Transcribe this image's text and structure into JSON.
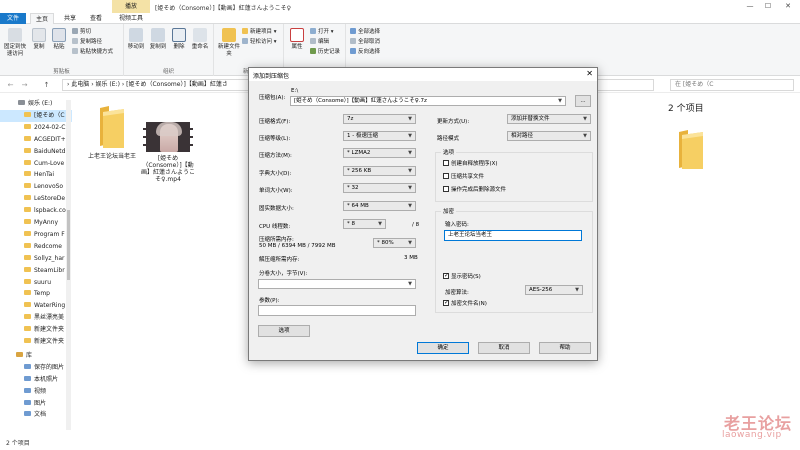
{
  "window": {
    "manage_tab": "播放",
    "title": "[姫そめ（Consome）]【動画】紅蓮さんようこそ♀",
    "minimize": "—",
    "maximize": "☐",
    "close": "✕"
  },
  "ribbon_tabs": {
    "file": "文件",
    "home": "主页",
    "share": "共享",
    "view": "查看",
    "tools": "视频工具"
  },
  "ribbon": {
    "clipboard": {
      "pin": "固定到快速访问",
      "copy": "复制",
      "paste": "粘贴",
      "cut": "剪切",
      "copy_path": "复制路径",
      "paste_shortcut": "粘贴快捷方式",
      "label": "剪贴板"
    },
    "organize": {
      "move_to": "移动到",
      "copy_to": "复制到",
      "delete": "删除",
      "rename": "重命名",
      "label": "组织"
    },
    "new": {
      "new_folder": "新建文件夹",
      "new_item": "新建项目 ▾",
      "easy_access": "轻松访问 ▾",
      "label": "新建"
    },
    "open": {
      "properties": "属性",
      "open": "打开 ▾",
      "edit": "编辑",
      "history": "历史记录"
    },
    "select": {
      "select_all": "全部选择",
      "select_none": "全部取消",
      "invert": "反向选择"
    }
  },
  "address": {
    "back": "←",
    "forward": "→",
    "up": "↑",
    "path": "›  此电脑  ›  娱乐 (E:)  ›  [姫そめ（Consome）]【動画】紅蓮さ",
    "search_placeholder": "在 [姫そめ（C"
  },
  "nav": {
    "items": [
      "娱乐 (E:)",
      "[姫そめ（C",
      "2024-02-C",
      "ACGEDIT+",
      "BaiduNetd",
      "Cum-Love",
      "HenTai",
      "LenovoSo",
      "LeStoreDe",
      "lspback.co",
      "MyAnny",
      "Program F",
      "Redcome",
      "Sollyz_har",
      "SteamLibr",
      "suuru",
      "Temp",
      "WaterRing",
      "黑丝漂亮美",
      "新建文件夹",
      "新建文件夹",
      "库",
      "保存的图片",
      "本机照片",
      "视频",
      "图片",
      "文档"
    ]
  },
  "files": {
    "folder_name": "上老王论坛当老王",
    "video_name": "[姫そめ（Consome）]【動画】紅蓮さんようこそ♀.mp4",
    "count": "2 个项目"
  },
  "status": {
    "count": "2 个项目"
  },
  "dialog": {
    "title": "添加到压缩包",
    "close": "✕",
    "archive_label": "压缩包(A):",
    "archive_dir": "E:\\",
    "archive_name": "[姫そめ（Consome）]【動画】紅蓮さんようこそ♀.7z",
    "browse": "...",
    "format_label": "压缩格式(F):",
    "format_value": "7z",
    "level_label": "压缩等级(L):",
    "level_value": "1 - 极速压缩",
    "method_label": "压缩方法(M):",
    "method_value": "* LZMA2",
    "dict_label": "字典大小(D):",
    "dict_value": "* 256 KB",
    "word_label": "单词大小(W):",
    "word_value": "* 32",
    "solid_label": "固实数据大小:",
    "solid_value": "* 64 MB",
    "threads_label": "CPU 线程数:",
    "threads_value": "* 8",
    "threads_max": "/ 8",
    "mem_label": "压缩所需内存:",
    "mem_value": "50 MB / 6394 MB / 7992 MB",
    "mem_pct": "* 80%",
    "decomp_label": "解压缩所需内存:",
    "decomp_value": "3 MB",
    "split_label": "分卷大小，字节(V):",
    "params_label": "参数(P):",
    "options_btn": "选项",
    "update_label": "更新方式(U):",
    "update_value": "添加并替换文件",
    "path_label": "路径模式",
    "path_value": "相对路径",
    "options_group": "选项",
    "opt_sfx": "创建自释放程序(X)",
    "opt_shared": "压缩共享文件",
    "opt_delete": "操作完成后删除源文件",
    "enc_group": "加密",
    "pwd_label": "输入密码:",
    "pwd_value": "上老王论坛当老王",
    "show_pwd": "显示密码(S)",
    "enc_method_label": "加密算法:",
    "enc_method_value": "AES-256",
    "enc_names": "加密文件名(N)",
    "ok": "确定",
    "cancel": "取消",
    "help": "帮助"
  },
  "watermark": {
    "cn": "老王论坛",
    "en": "laowang.vip"
  }
}
